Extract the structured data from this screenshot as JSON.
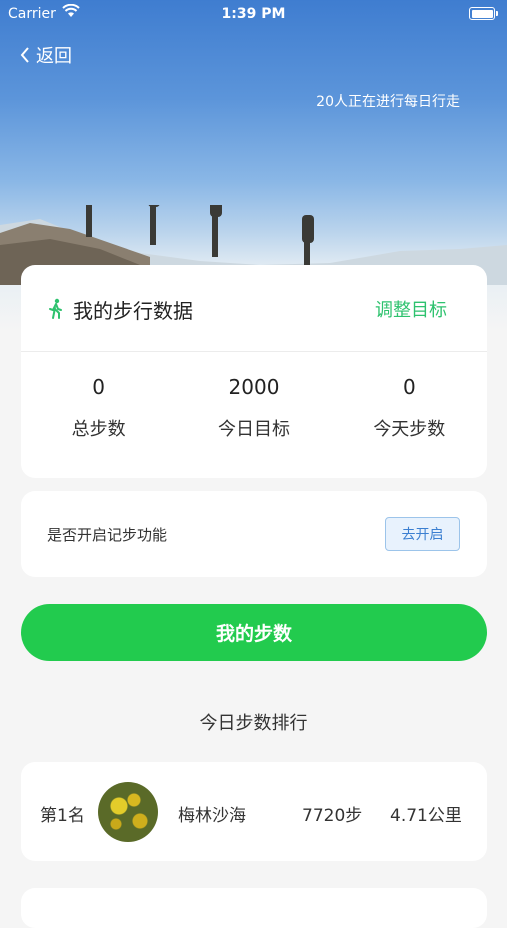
{
  "status_bar": {
    "carrier": "Carrier",
    "time": "1:39 PM"
  },
  "nav": {
    "back_label": "返回"
  },
  "hero": {
    "note": "20人正在进行每日行走"
  },
  "my_data": {
    "title": "我的步行数据",
    "adjust_label": "调整目标",
    "stats": [
      {
        "value": "0",
        "label": "总步数"
      },
      {
        "value": "2000",
        "label": "今日目标"
      },
      {
        "value": "0",
        "label": "今天步数"
      }
    ]
  },
  "step_toggle": {
    "label": "是否开启记步功能",
    "button_label": "去开启"
  },
  "main_button": {
    "label": "我的步数"
  },
  "ranking": {
    "title": "今日步数排行",
    "items": [
      {
        "rank": "第1名",
        "name": "梅林沙海",
        "steps": "7720步",
        "distance": "4.71公里"
      }
    ]
  },
  "colors": {
    "accent_green": "#22cb4e",
    "link_green": "#2ec26e",
    "toggle_blue": "#3b7fd1"
  }
}
